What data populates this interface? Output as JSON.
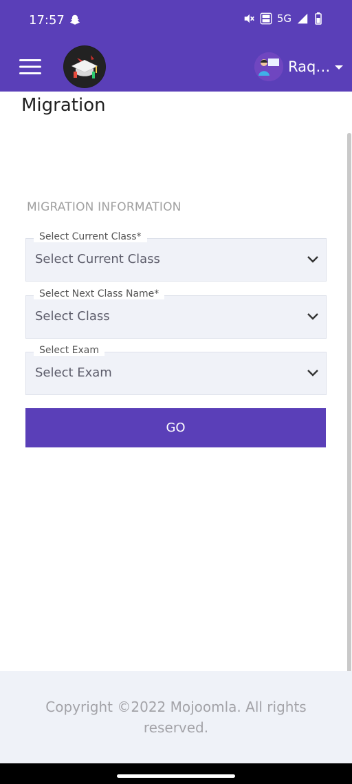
{
  "status_bar": {
    "time": "17:57",
    "network": "5G",
    "icons": [
      "snapchat-icon",
      "mute-icon",
      "volte-icon",
      "signal-icon",
      "battery-icon"
    ]
  },
  "header": {
    "user_name": "Raq…",
    "accent_color": "#5a3fb8",
    "icons": [
      "menu-icon",
      "app-logo",
      "user-avatar",
      "caret-down-icon"
    ]
  },
  "page": {
    "title": "Migration"
  },
  "form": {
    "section_title": "MIGRATION INFORMATION",
    "fields": [
      {
        "label": "Select Current Class*",
        "value": "Select Current Class"
      },
      {
        "label": "Select Next Class Name*",
        "value": "Select Class"
      },
      {
        "label": "Select Exam",
        "value": "Select Exam"
      }
    ],
    "go_label": "GO"
  },
  "footer": {
    "copyright": "Copyright ©2022 Mojoomla. All rights reserved."
  }
}
